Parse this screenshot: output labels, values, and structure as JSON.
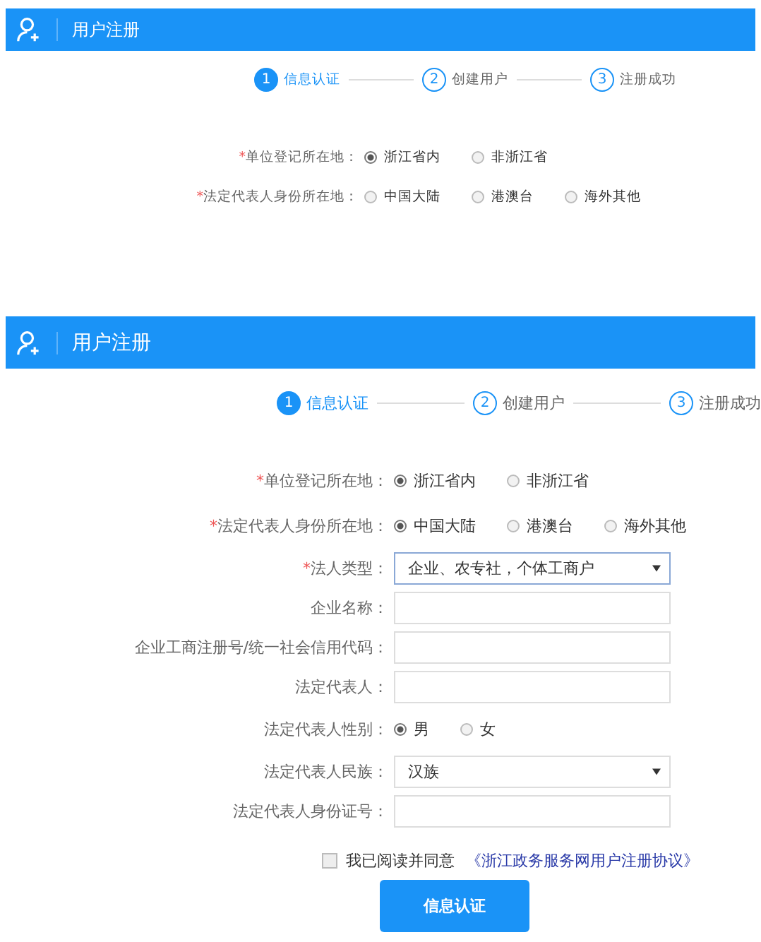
{
  "panels": [
    {
      "title": "用户注册",
      "steps": [
        {
          "number": "1",
          "label": "信息认证",
          "selected": true
        },
        {
          "number": "2",
          "label": "创建用户",
          "selected": false
        },
        {
          "number": "3",
          "label": "注册成功",
          "selected": false
        }
      ],
      "fields": [
        {
          "kind": "radio",
          "mark": "*",
          "label": "单位登记所在地：",
          "options": [
            {
              "label": "浙江省内",
              "selected": true
            },
            {
              "label": "非浙江省",
              "selected": false
            }
          ]
        },
        {
          "kind": "radio",
          "mark": "*",
          "label": "法定代表人身份所在地：",
          "options": [
            {
              "label": "中国大陆",
              "selected": false
            },
            {
              "label": "港澳台",
              "selected": false
            },
            {
              "label": "海外其他",
              "selected": false
            }
          ]
        }
      ]
    },
    {
      "title": "用户注册",
      "steps": [
        {
          "number": "1",
          "label": "信息认证",
          "selected": true
        },
        {
          "number": "2",
          "label": "创建用户",
          "selected": false
        },
        {
          "number": "3",
          "label": "注册成功",
          "selected": false
        }
      ],
      "fields": [
        {
          "kind": "radio",
          "mark": "*",
          "label": "单位登记所在地：",
          "options": [
            {
              "label": "浙江省内",
              "selected": true
            },
            {
              "label": "非浙江省",
              "selected": false
            }
          ]
        },
        {
          "kind": "radio",
          "mark": "*",
          "label": "法定代表人身份所在地：",
          "options": [
            {
              "label": "中国大陆",
              "selected": true
            },
            {
              "label": "港澳台",
              "selected": false
            },
            {
              "label": "海外其他",
              "selected": false
            }
          ]
        },
        {
          "kind": "select",
          "mark": "*",
          "label": "法人类型：",
          "value": "企业、农专社，个体工商户"
        },
        {
          "kind": "text",
          "label": "企业名称："
        },
        {
          "kind": "text",
          "label": "企业工商注册号/统一社会信用代码："
        },
        {
          "kind": "text",
          "label": "法定代表人："
        },
        {
          "kind": "radio",
          "label": "法定代表人性别：",
          "options": [
            {
              "label": "男",
              "selected": true
            },
            {
              "label": "女",
              "selected": false
            }
          ]
        },
        {
          "kind": "select",
          "label": "法定代表人民族：",
          "value": "汉族"
        },
        {
          "kind": "text",
          "label": "法定代表人身份证号："
        }
      ],
      "agreement": {
        "checked": false,
        "text": "我已阅读并同意",
        "link": "《浙江政务服务网用户注册协议》"
      },
      "submit": "信息认证"
    }
  ]
}
